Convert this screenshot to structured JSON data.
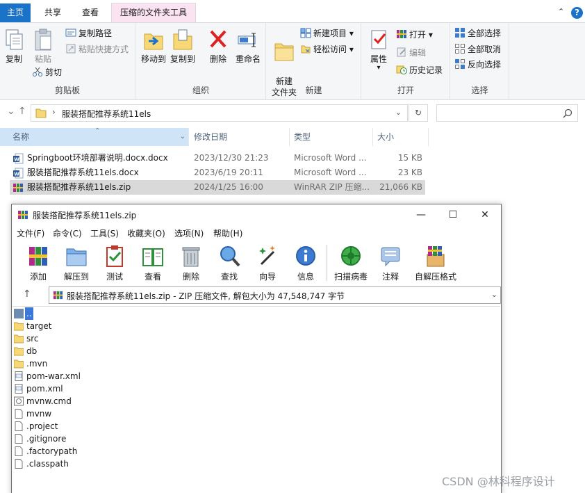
{
  "explorer": {
    "tabs": [
      "主页",
      "共享",
      "查看",
      "压缩的文件夹工具"
    ],
    "ribbon_controls": {
      "minimize": "⌃",
      "help": "?"
    },
    "ribbon": {
      "clipboard": {
        "label": "剪贴板",
        "copy": "复制",
        "paste": "粘贴",
        "copy_path": "复制路径",
        "paste_shortcut": "粘贴快捷方式",
        "cut": "剪切"
      },
      "organize": {
        "label": "组织",
        "move_to": "移动到",
        "copy_to": "复制到",
        "delete": "删除",
        "rename": "重命名"
      },
      "new": {
        "label": "新建",
        "new_folder": "新建\n文件夹",
        "new_item": "新建项目",
        "easy_access": "轻松访问"
      },
      "open": {
        "label": "打开",
        "properties": "属性",
        "open": "打开",
        "edit": "编辑",
        "history": "历史记录"
      },
      "select": {
        "label": "选择",
        "select_all": "全部选择",
        "select_none": "全部取消",
        "invert": "反向选择"
      }
    },
    "address": {
      "path": "服装搭配推荐系统11els"
    },
    "columns": {
      "name": "名称",
      "date": "修改日期",
      "type": "类型",
      "size": "大小"
    },
    "files": [
      {
        "name": "Springboot环境部署说明.docx.docx",
        "date": "2023/12/30 21:23",
        "type": "Microsoft Word ...",
        "size": "15 KB",
        "icon": "word-doc-icon"
      },
      {
        "name": "服装搭配推荐系统11els.docx",
        "date": "2023/6/19 20:11",
        "type": "Microsoft Word ...",
        "size": "23 KB",
        "icon": "word-doc-icon"
      },
      {
        "name": "服装搭配推荐系统11els.zip",
        "date": "2024/1/25 16:00",
        "type": "WinRAR ZIP 压缩...",
        "size": "21,066 KB",
        "icon": "winrar-zip-icon"
      }
    ]
  },
  "winrar": {
    "title": "服装搭配推荐系统11els.zip",
    "window_buttons": {
      "minimize": "—",
      "maximize": "☐",
      "close": "✕"
    },
    "menu": [
      "文件(F)",
      "命令(C)",
      "工具(S)",
      "收藏夹(O)",
      "选项(N)",
      "帮助(H)"
    ],
    "toolbar": [
      "添加",
      "解压到",
      "测试",
      "查看",
      "删除",
      "查找",
      "向导",
      "信息",
      "扫描病毒",
      "注释",
      "自解压格式"
    ],
    "path_bar": "服装搭配推荐系统11els.zip - ZIP 压缩文件, 解包大小为 47,548,747 字节",
    "items": [
      {
        "name": "..",
        "kind": "up"
      },
      {
        "name": "target",
        "kind": "folder"
      },
      {
        "name": "src",
        "kind": "folder"
      },
      {
        "name": "db",
        "kind": "folder"
      },
      {
        "name": ".mvn",
        "kind": "folder"
      },
      {
        "name": "pom-war.xml",
        "kind": "xml"
      },
      {
        "name": "pom.xml",
        "kind": "xml"
      },
      {
        "name": "mvnw.cmd",
        "kind": "cmd"
      },
      {
        "name": "mvnw",
        "kind": "file"
      },
      {
        "name": ".project",
        "kind": "file"
      },
      {
        "name": ".gitignore",
        "kind": "file"
      },
      {
        "name": ".factorypath",
        "kind": "file"
      },
      {
        "name": ".classpath",
        "kind": "file"
      }
    ]
  },
  "watermark": "CSDN @林科程序设计"
}
